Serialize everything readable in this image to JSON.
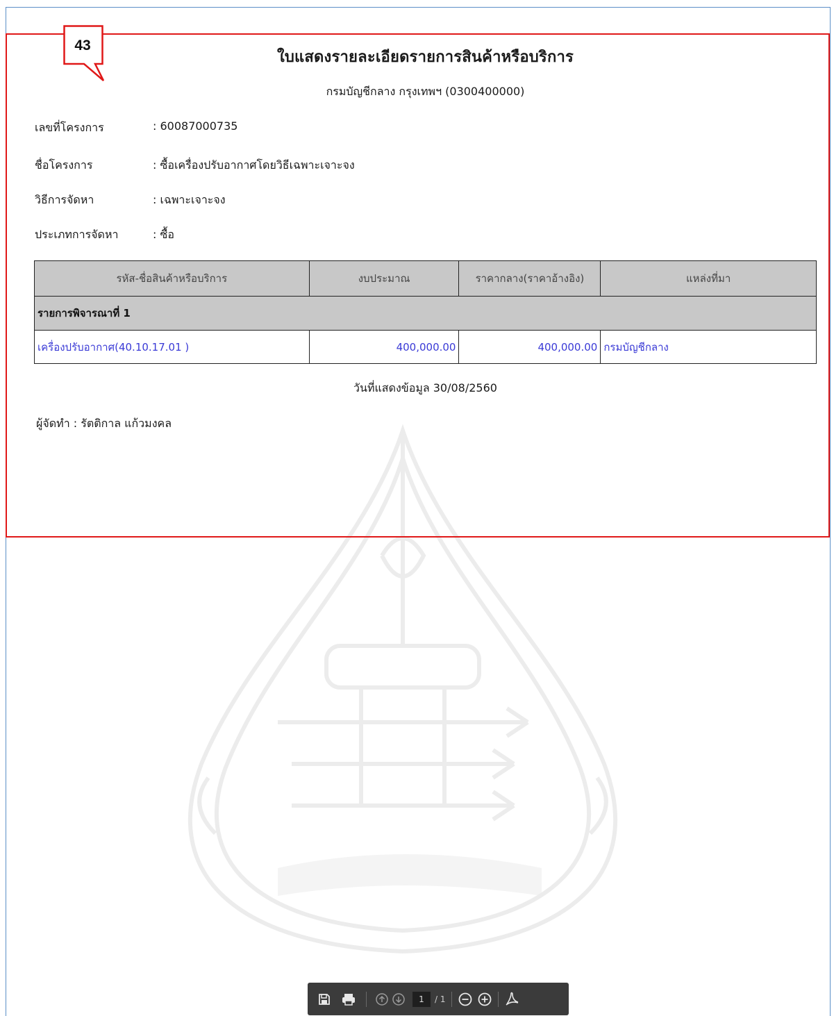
{
  "callout": {
    "number": "43"
  },
  "document": {
    "title": "ใบแสดงรายละเอียดรายการสินค้าหรือบริการ",
    "subtitle": "กรมบัญชีกลาง กรุงเทพฯ (0300400000)",
    "fields": [
      {
        "label": "เลขที่โครงการ",
        "value": ": 60087000735"
      },
      {
        "label": "ชื่อโครงการ",
        "value": ": ซื้อเครื่องปรับอากาศโดยวิธีเฉพาะเจาะจง"
      },
      {
        "label": "วิธีการจัดหา",
        "value": ": เฉพาะเจาะจง"
      },
      {
        "label": "ประเภทการจัดหา",
        "value": ": ซื้อ"
      }
    ],
    "table": {
      "headers": [
        "รหัส-ชื่อสินค้าหรือบริการ",
        "งบประมาณ",
        "ราคากลาง(ราคาอ้างอิง)",
        "แหล่งที่มา"
      ],
      "group_label": "รายการพิจารณาที่ 1",
      "rows": [
        {
          "item": "เครื่องปรับอากาศ(40.10.17.01 )",
          "budget": "400,000.00",
          "reference_price": "400,000.00",
          "source": "กรมบัญชีกลาง"
        }
      ],
      "colors": {
        "header_bg": "#c8c8c8",
        "link_text": "#3a3ad6"
      }
    },
    "display_date": "วันที่แสดงข้อมูล 30/08/2560",
    "creator": "ผู้จัดทำ : รัตติกาล แก้วมงคล"
  },
  "toolbar": {
    "icons": [
      "save-icon",
      "print-icon",
      "previous-page-icon",
      "next-page-icon",
      "zoom-out-icon",
      "zoom-in-icon",
      "acrobat-icon"
    ],
    "current_page": "1",
    "total_pages": "/ 1"
  },
  "colors": {
    "highlight_border": "#e01818",
    "frame_border": "#5b8fc7",
    "toolbar_bg": "#3b3b3b"
  }
}
